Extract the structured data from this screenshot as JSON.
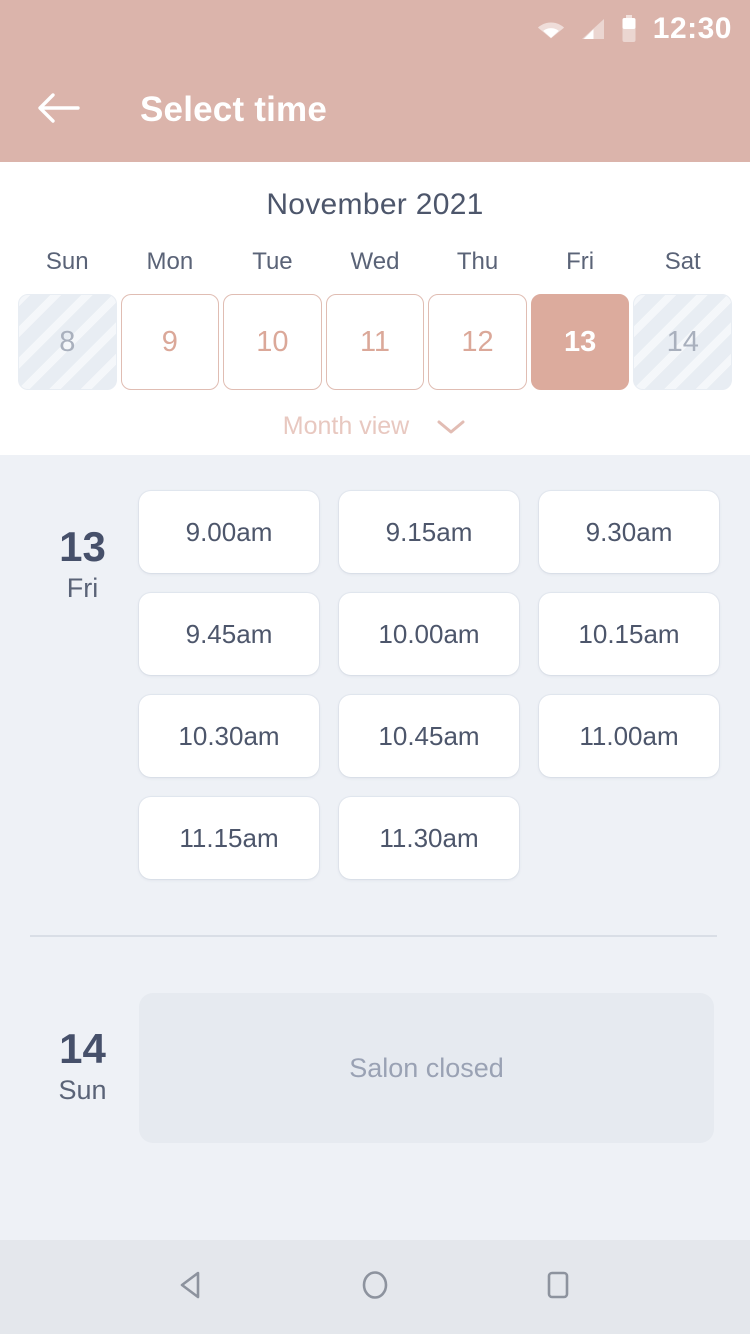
{
  "status_bar": {
    "time": "12:30",
    "icons": [
      "wifi-icon",
      "cellular-signal-icon",
      "battery-icon"
    ]
  },
  "app_bar": {
    "title": "Select time",
    "back_icon": "arrow-left-icon"
  },
  "calendar": {
    "month_title": "November 2021",
    "weekday_headers": [
      "Sun",
      "Mon",
      "Tue",
      "Wed",
      "Thu",
      "Fri",
      "Sat"
    ],
    "days": [
      {
        "num": "8",
        "state": "disabled"
      },
      {
        "num": "9",
        "state": "enabled"
      },
      {
        "num": "10",
        "state": "enabled"
      },
      {
        "num": "11",
        "state": "enabled"
      },
      {
        "num": "12",
        "state": "enabled"
      },
      {
        "num": "13",
        "state": "selected"
      },
      {
        "num": "14",
        "state": "disabled"
      }
    ],
    "view_toggle_label": "Month view",
    "view_toggle_icon": "chevron-down-icon",
    "colors": {
      "accent": "#dcab9d",
      "accent_bar": "#dbb4ab",
      "day_border": "#e0bdb3",
      "day_text": "#dba899",
      "disabled_bg": "#e8edf3",
      "title_text": "#4d566b",
      "month_view_text": "#e8c8c0"
    }
  },
  "schedule": {
    "days": [
      {
        "day_num": "13",
        "day_name": "Fri",
        "closed": false,
        "slots": [
          "9.00am",
          "9.15am",
          "9.30am",
          "9.45am",
          "10.00am",
          "10.15am",
          "10.30am",
          "10.45am",
          "11.00am",
          "11.15am",
          "11.30am"
        ]
      },
      {
        "day_num": "14",
        "day_name": "Sun",
        "closed": true,
        "closed_label": "Salon closed",
        "slots": []
      }
    ],
    "colors": {
      "background": "#eef1f6",
      "slot_bg": "#ffffff",
      "slot_text": "#4d566b",
      "day_num_text": "#46506a",
      "closed_card_bg": "#e6eaf0",
      "closed_text": "#9aa2b4",
      "divider": "#d9dee6"
    }
  },
  "nav_bar": {
    "buttons": [
      {
        "name": "back-nav-icon",
        "shape": "triangle-left"
      },
      {
        "name": "home-nav-icon",
        "shape": "circle"
      },
      {
        "name": "recents-nav-icon",
        "shape": "square"
      }
    ]
  }
}
